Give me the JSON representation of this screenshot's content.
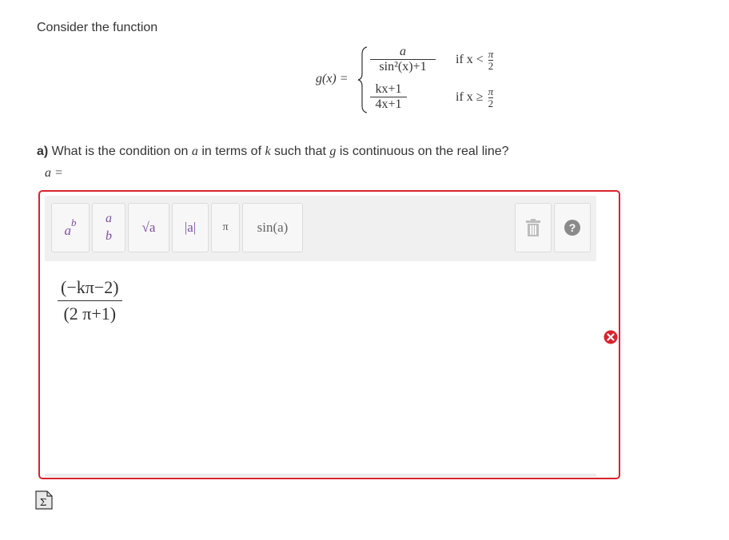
{
  "prompt": "Consider the function",
  "function": {
    "lhs": "g(x) =",
    "case1": {
      "num": "a",
      "den": "sin²(x)+1",
      "cond_prefix": "if x <",
      "cond_num": "π",
      "cond_den": "2"
    },
    "case2": {
      "num": "kx+1",
      "den": "4x+1",
      "cond_prefix": "if x ≥",
      "cond_num": "π",
      "cond_den": "2"
    }
  },
  "question": {
    "part": "a)",
    "t1": " What is the condition on ",
    "v1": "a",
    "t2": " in terms of ",
    "v2": "k",
    "t3": " such that ",
    "v3": "g",
    "t4": " is continuous on the real line?"
  },
  "answer_label": "a =",
  "toolbar": {
    "power": {
      "base": "a",
      "exp": "b"
    },
    "fraction": {
      "num": "a",
      "den": "b"
    },
    "sqrt": "√a",
    "abs": "|a|",
    "pi": "π",
    "sin": "sin(a)",
    "trash_icon": "trash-icon",
    "help_icon": "help-icon"
  },
  "answer": {
    "num": "(−kπ−2)",
    "den": "(2 π+1)"
  },
  "status": {
    "state": "incorrect",
    "color": "#d9232d"
  },
  "icons": {
    "error": "error-x-icon",
    "formula": "formula-sigma-icon"
  }
}
